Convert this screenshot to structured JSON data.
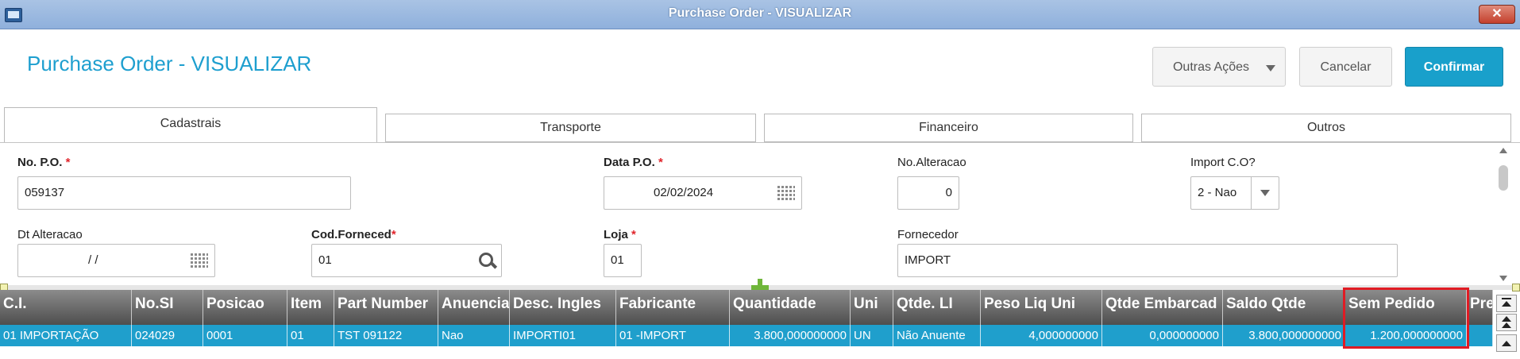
{
  "window": {
    "title": "Purchase Order - VISUALIZAR",
    "close_label": "✕"
  },
  "header": {
    "page_title": "Purchase Order - VISUALIZAR",
    "buttons": {
      "outras": "Outras Ações",
      "cancelar": "Cancelar",
      "confirmar": "Confirmar"
    }
  },
  "tabs": [
    {
      "label": "Cadastrais",
      "active": true
    },
    {
      "label": "Transporte"
    },
    {
      "label": "Financeiro"
    },
    {
      "label": "Outros"
    }
  ],
  "form": {
    "no_po": {
      "label": "No. P.O.",
      "required": "*",
      "value": "059137"
    },
    "data_po": {
      "label": "Data P.O.",
      "required": "*",
      "value": "02/02/2024"
    },
    "no_alteracao": {
      "label": "No.Alteracao",
      "value": "0"
    },
    "import_co": {
      "label": "Import C.O?",
      "value": "2 - Nao"
    },
    "dt_alteracao": {
      "label": "Dt Alteracao",
      "value": "/ /"
    },
    "cod_forneced": {
      "label": "Cod.Forneced",
      "required": "*",
      "value": "01"
    },
    "loja": {
      "label": "Loja",
      "required": "*",
      "value": "01"
    },
    "fornecedor": {
      "label": "Fornecedor",
      "value": "IMPORT"
    }
  },
  "grid": {
    "columns": [
      "C.I.",
      "No.SI",
      "Posicao",
      "Item",
      "Part Number",
      "Anuencia",
      "Desc. Ingles",
      "Fabricante",
      "Quantidade",
      "Uni",
      "Qtde. LI",
      "Peso Liq Uni",
      "Qtde Embarcad",
      "Saldo Qtde",
      "Sem Pedido",
      "Pre"
    ],
    "rows": [
      [
        "01   IMPORTAÇÃO",
        "024029",
        "0001",
        "01",
        "TST 091122",
        "Nao",
        "IMPORTI01",
        "01      -IMPORT",
        "3.800,000000000",
        "UN",
        "Não Anuente",
        "4,000000000",
        "0,000000000",
        "3.800,000000000",
        "1.200,000000000",
        ""
      ]
    ]
  },
  "colors": {
    "accent": "#1e9fcf",
    "row_selected": "#1f9fcc",
    "highlight": "#e01b24"
  }
}
